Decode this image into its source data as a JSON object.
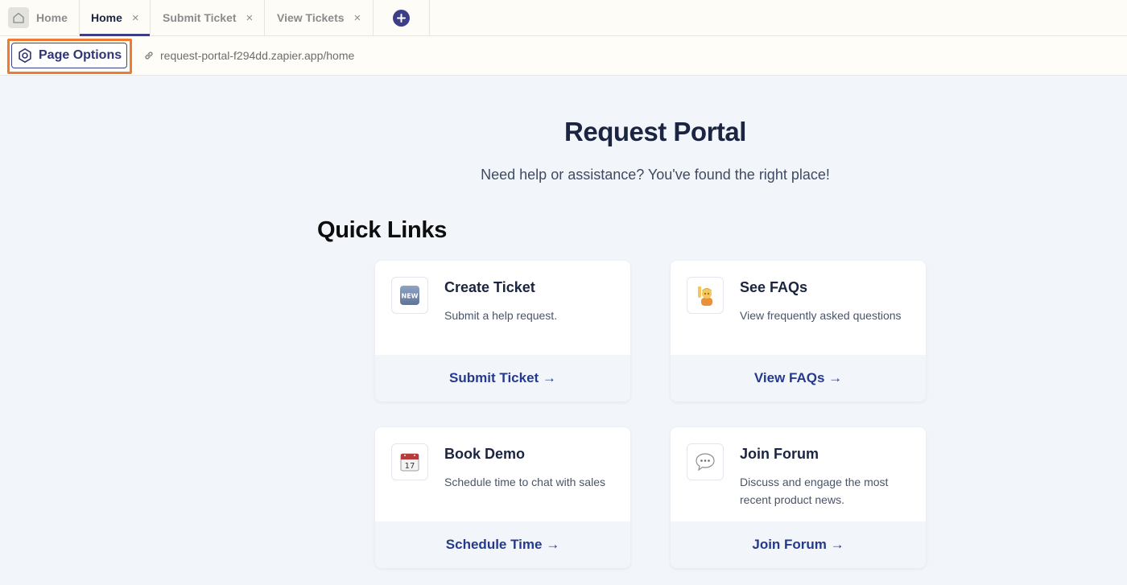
{
  "tabs": [
    {
      "label": "Home",
      "closable": false,
      "active": false
    },
    {
      "label": "Home",
      "closable": true,
      "active": true
    },
    {
      "label": "Submit Ticket",
      "closable": true,
      "active": false
    },
    {
      "label": "View Tickets",
      "closable": true,
      "active": false
    }
  ],
  "close_glyph": "×",
  "address": {
    "page_options_label": "Page Options",
    "url": "request-portal-f294dd.zapier.app/home"
  },
  "main": {
    "title": "Request Portal",
    "subtitle": "Need help or assistance? You've found the right place!",
    "quick_links_heading": "Quick Links",
    "cards": [
      {
        "icon": "new-badge-icon",
        "title": "Create Ticket",
        "description": "Submit a help request.",
        "link": "Submit Ticket →"
      },
      {
        "icon": "person-raising-hand-icon",
        "title": "See FAQs",
        "description": "View frequently asked questions",
        "link": "View FAQs →"
      },
      {
        "icon": "calendar-icon",
        "title": "Book Demo",
        "description": "Schedule time to chat with sales",
        "link": "Schedule Time →"
      },
      {
        "icon": "speech-bubble-icon",
        "title": "Join Forum",
        "description": "Discuss and engage the most recent product news.",
        "link": "Join Forum →"
      }
    ],
    "calendar_day": "17",
    "new_badge_text": "NEW"
  },
  "colors": {
    "accent": "#3d3f86",
    "highlight": "#ef7a34",
    "link": "#253a8c",
    "background": "#f2f6fb"
  }
}
